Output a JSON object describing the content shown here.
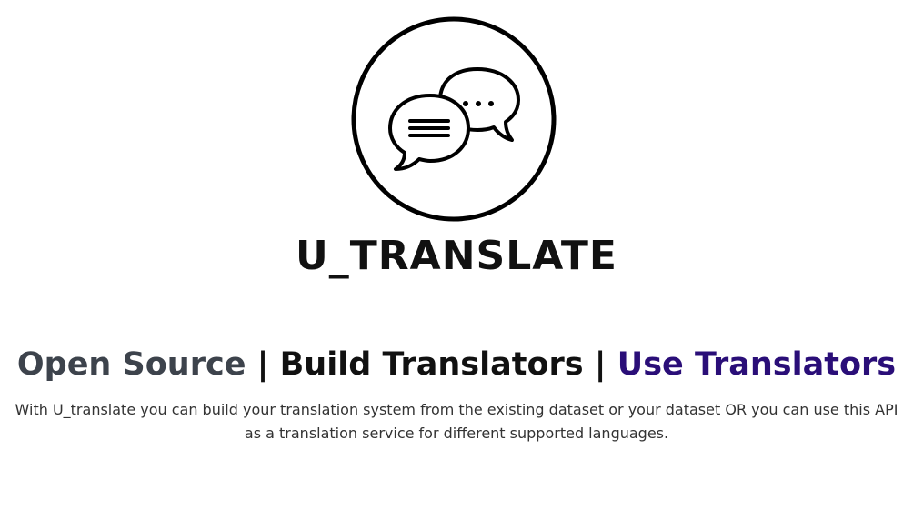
{
  "logo": {
    "icon": "chat-bubbles-icon",
    "wordmark": "U_TRANSLATE"
  },
  "headline": {
    "open_source": "Open Source",
    "build_translators": "Build Translators",
    "use_translators": "Use Translators",
    "separator": "|"
  },
  "description": "With U_translate you can build your translation system from the existing dataset or your dataset OR you can use this API as a translation service for different supported languages.",
  "colors": {
    "open_source": "#3d434c",
    "build_translators": "#111111",
    "use_translators": "#2a0e78",
    "body_text": "#333333"
  }
}
